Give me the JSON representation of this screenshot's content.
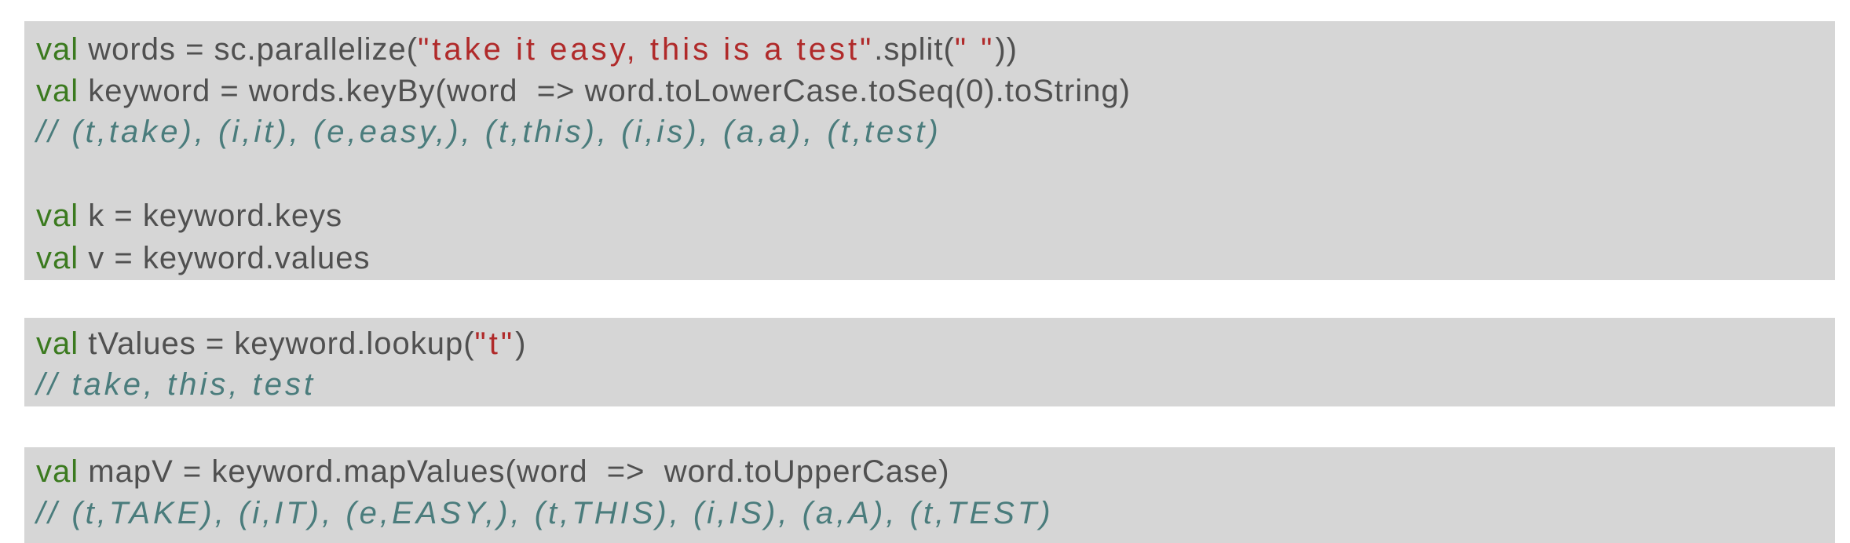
{
  "blocks": [
    {
      "lines": [
        {
          "kw": "val",
          "text_a": " words = sc.parallelize(",
          "str": "\"take it easy, this is a test\"",
          "text_b": ".split(",
          "str2": "\" \"",
          "text_c": "))"
        },
        {
          "kw": "val",
          "text_a": " keyword = words.keyBy(word  => word.toLowerCase.toSeq(0).toString)"
        },
        {
          "comment": "// (t,take), (i,it), (e,easy,), (t,this), (i,is), (a,a), (t,test)"
        },
        {
          "kw": "val",
          "text_a": " k = keyword.keys"
        },
        {
          "kw": "val",
          "text_a": " v = keyword.values"
        }
      ]
    },
    {
      "lines": [
        {
          "kw": "val",
          "text_a": " tValues = keyword.lookup(",
          "str": "\"t\"",
          "text_b": ")"
        },
        {
          "comment": "// take, this, test"
        }
      ]
    },
    {
      "lines": [
        {
          "kw": "val",
          "text_a": " mapV = keyword.mapValues(word  =>  word.toUpperCase)"
        },
        {
          "comment": "// (t,TAKE), (i,IT), (e,EASY,), (t,THIS), (i,IS), (a,A), (t,TEST)"
        }
      ]
    }
  ]
}
